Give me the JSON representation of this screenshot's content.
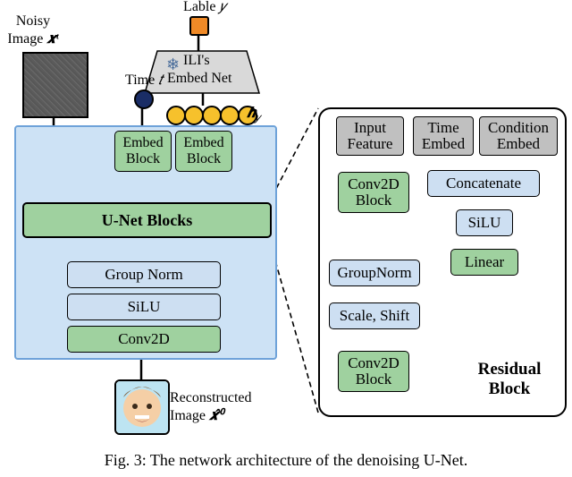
{
  "labels": {
    "noisy_image_title": "Noisy",
    "noisy_image_sub": "Image",
    "xt": "𝒙ᵗ",
    "time_lbl": "Time",
    "t": "𝑡",
    "label_y_title": "Lable",
    "y": "𝑦",
    "hy_prefix": "𝒉",
    "hy_sub": "𝑦",
    "reconstructed1": "Reconstructed",
    "reconstructed2": "Image",
    "xhat": "𝒙̂⁰"
  },
  "blocks": {
    "ili_l1": "ILI's",
    "ili_l2": "Embed Net",
    "embed_block_l1": "Embed",
    "embed_block_l2": "Block",
    "unet": "U-Net Blocks",
    "groupnorm": "Group Norm",
    "silu": "SiLU",
    "conv2d": "Conv2D"
  },
  "right": {
    "hdr_input_l1": "Input",
    "hdr_input_l2": "Feature",
    "hdr_time_l1": "Time",
    "hdr_time_l2": "Embed",
    "hdr_cond_l1": "Condition",
    "hdr_cond_l2": "Embed",
    "conv2d_l1": "Conv2D",
    "conv2d_l2": "Block",
    "concatenate": "Concatenate",
    "silu": "SiLU",
    "linear": "Linear",
    "groupnorm": "GroupNorm",
    "scale_shift": "Scale, Shift",
    "title_l1": "Residual",
    "title_l2": "Block"
  },
  "caption": "Fig. 3: The network architecture of the denoising U-Net."
}
